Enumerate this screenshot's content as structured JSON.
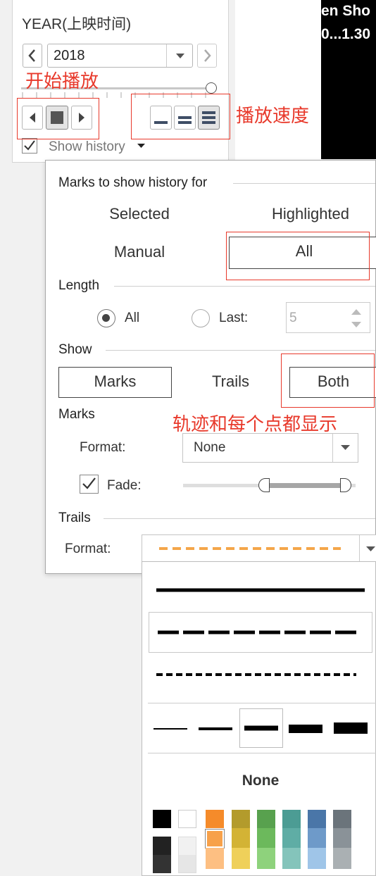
{
  "filter": {
    "title": "YEAR(上映时间)",
    "year_value": "2018",
    "show_history_label": "Show history"
  },
  "viz_text": {
    "line1": "en Sho",
    "line2": "0...1.30"
  },
  "annotations": {
    "start_play": "开始播放",
    "play_speed": "播放速度",
    "trails_and_points": "轨迹和每个点都显示"
  },
  "history": {
    "marks_header": "Marks to show history for",
    "selected": "Selected",
    "highlighted": "Highlighted",
    "manual": "Manual",
    "all": "All",
    "length_header": "Length",
    "length_all": "All",
    "length_last": "Last:",
    "last_value": "5",
    "show_header": "Show",
    "show_marks": "Marks",
    "show_trails": "Trails",
    "show_both": "Both",
    "marks_section": "Marks",
    "format_label": "Format:",
    "format_value": "None",
    "fade_label": "Fade:",
    "trails_section": "Trails",
    "trails_format_label": "Format:"
  },
  "dropdown": {
    "none_label": "None"
  },
  "colors": {
    "accent": "#e8392b",
    "trail_dash": "#f4a64a",
    "swatches": [
      "#000000",
      "#ffffff",
      "#f58b2a",
      "#b39b2c",
      "#58a14e",
      "#4c9c94",
      "#4a76a8",
      "#6b747b"
    ]
  },
  "icons": [
    "chevron-left-icon",
    "chevron-right-icon",
    "dropdown-arrow-icon",
    "play-back-icon",
    "stop-icon",
    "play-forward-icon",
    "speed-slow-icon",
    "speed-medium-icon",
    "speed-fast-icon",
    "checkbox-checked-icon",
    "radio-icon",
    "spinner-up-icon",
    "spinner-down-icon"
  ]
}
